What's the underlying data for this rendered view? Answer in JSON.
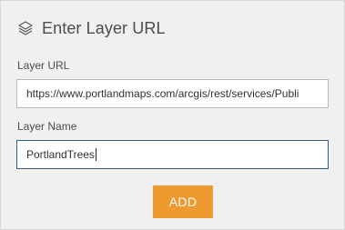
{
  "header": {
    "icon": "layers-icon",
    "title": "Enter Layer URL"
  },
  "form": {
    "url_label": "Layer URL",
    "url_value": "https://www.portlandmaps.com/arcgis/rest/services/Publi",
    "name_label": "Layer Name",
    "name_value": "PortlandTrees"
  },
  "actions": {
    "add_label": "ADD"
  },
  "colors": {
    "panel_bg": "#f0f0f0",
    "accent_button": "#ef9a30",
    "focused_border": "#2f5f8a",
    "text": "#4c4c4c"
  }
}
